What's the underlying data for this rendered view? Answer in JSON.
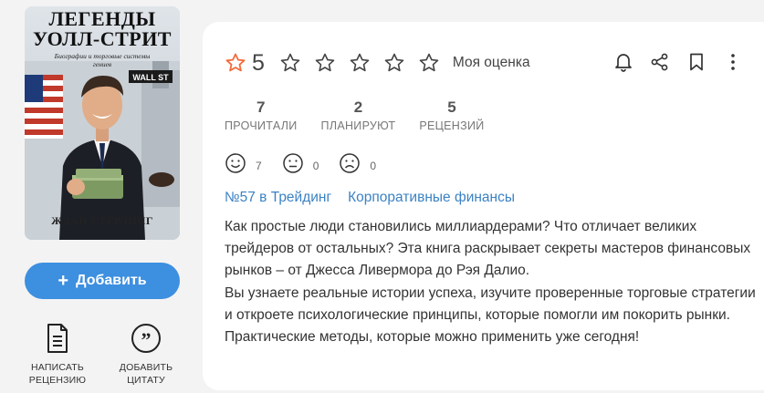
{
  "cover": {
    "title_line1": "ЛЕГЕНДЫ",
    "title_line2": "УОЛЛ-СТРИТ",
    "subtitle_line1": "Биографии и торговые системы",
    "subtitle_line2": "гениев",
    "author": "ЖДАН СТЕРЛИНГ",
    "street_sign": "WALL ST"
  },
  "add_button": {
    "icon": "plus-icon",
    "label": "Добавить"
  },
  "actions": {
    "review": {
      "icon": "document-icon",
      "label_line1": "НАПИСАТЬ",
      "label_line2": "РЕЦЕНЗИЮ"
    },
    "quote": {
      "icon": "quote-icon",
      "label_line1": "ДОБАВИТЬ",
      "label_line2": "ЦИТАТУ"
    }
  },
  "rating": {
    "value": "5",
    "my_rating_label": "Моя оценка",
    "my_rating_stars": 0,
    "accent_color": "#f26b3a"
  },
  "top_icons": [
    "bell-icon",
    "share-icon",
    "bookmark-icon",
    "more-vertical-icon"
  ],
  "stats": [
    {
      "num": "7",
      "caption": "ПРОЧИТАЛИ"
    },
    {
      "num": "2",
      "caption": "ПЛАНИРУЮТ"
    },
    {
      "num": "5",
      "caption": "РЕЦЕНЗИЙ"
    }
  ],
  "reactions": [
    {
      "icon": "smile-icon",
      "count": "7"
    },
    {
      "icon": "neutral-face-icon",
      "count": "0"
    },
    {
      "icon": "sad-face-icon",
      "count": "0"
    }
  ],
  "tags": [
    "№57 в Трейдинг",
    "Корпоративные финансы"
  ],
  "description": {
    "p1": "Как простые люди становились миллиардерами? Что отличает великих трейдеров от остальных? Эта книга раскрывает секреты мастеров финансовых рынков – от Джесса Ливермора до Рэя Далио.",
    "p2": "Вы узнаете реальные истории успеха, изучите проверенные торговые стратегии и откроете психологические принципы, которые помогли им покорить рынки. Практические методы, которые можно применить уже сегодня!"
  },
  "colors": {
    "primary": "#3d8fe0",
    "link": "#3b82c4",
    "star_accent": "#f26b3a"
  }
}
